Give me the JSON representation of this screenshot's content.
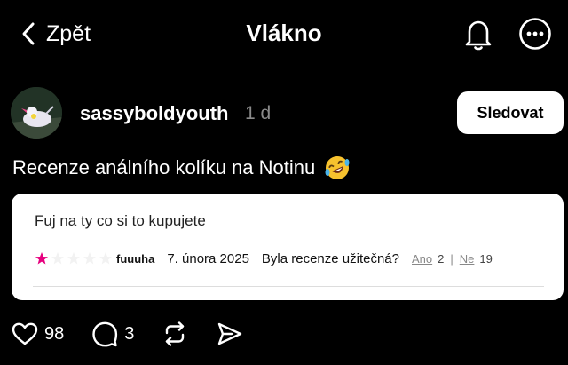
{
  "header": {
    "back_label": "Zpět",
    "title": "Vlákno"
  },
  "post": {
    "username": "sassyboldyouth",
    "time": "1 d",
    "follow_label": "Sledovat",
    "text": "Recenze análního kolíku na Notinu",
    "emoji": "rolling-on-floor-laughing"
  },
  "review": {
    "text": "Fuj na ty co si to kupujete",
    "rating": 1,
    "max_rating": 5,
    "star_color": "#e6007e",
    "reviewer": "fuuuha",
    "date": "7. února 2025",
    "question": "Byla recenze užitečná?",
    "yes_label": "Ano",
    "yes_count": "2",
    "separator": "|",
    "no_label": "Ne",
    "no_count": "19"
  },
  "actions": {
    "likes": "98",
    "comments": "3"
  }
}
